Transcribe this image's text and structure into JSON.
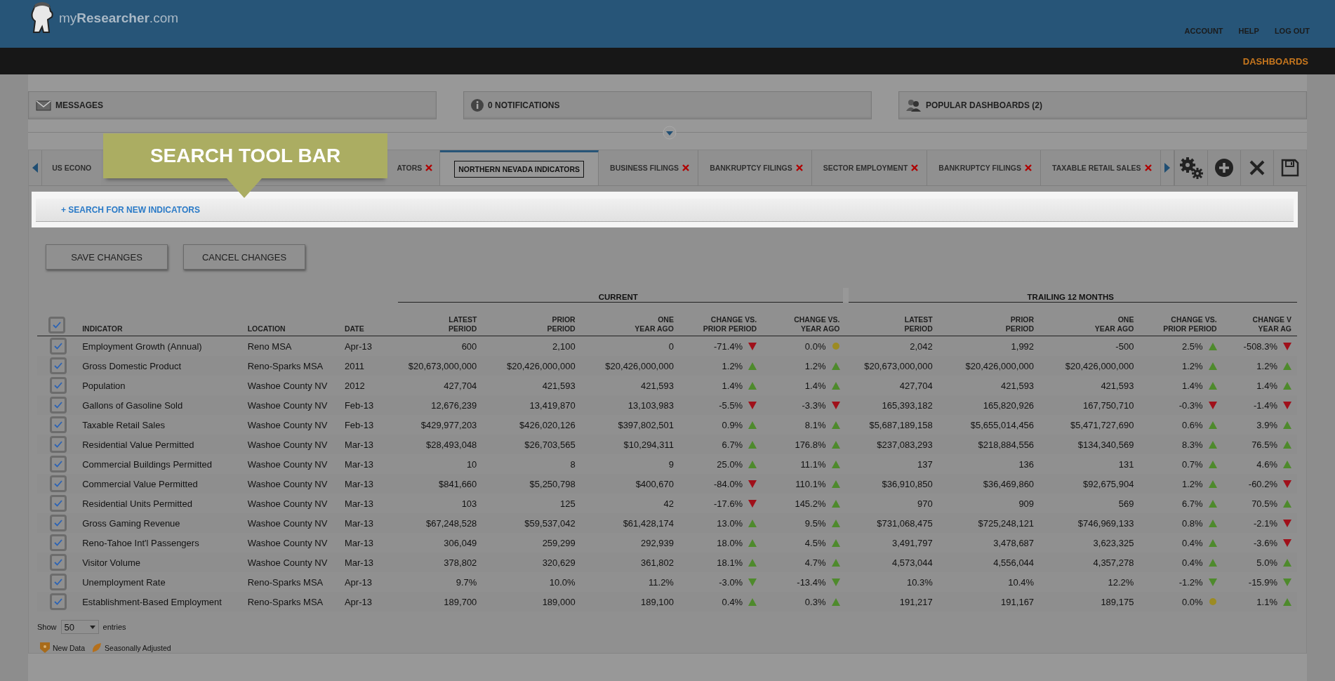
{
  "header": {
    "logo": "my**Researcher**.com",
    "links": [
      "ACCOUNT",
      "HELP",
      "LOG OUT"
    ]
  },
  "nav": {
    "items": [
      {
        "label": "DASHBOARDS",
        "selected": true
      }
    ]
  },
  "panels": [
    {
      "kind": "messages",
      "label": "MESSAGES"
    },
    {
      "kind": "notifications",
      "label": "0 NOTIFICATIONS"
    },
    {
      "kind": "popular",
      "label": "POPULAR DASHBOARDS (2)"
    }
  ],
  "tabs": [
    {
      "label": "US ECONO",
      "closable": false,
      "selected": false,
      "kind": "covered-start"
    },
    {
      "label": "ATORS",
      "closable": true,
      "selected": false,
      "kind": "covered-end"
    },
    {
      "label": "NORTHERN NEVADA INDICATORS",
      "closable": false,
      "selected": true,
      "kind": "tab"
    },
    {
      "label": "BUSINESS FILINGS",
      "closable": true,
      "selected": false,
      "kind": "tab"
    },
    {
      "label": "BANKRUPTCY FILINGS",
      "closable": true,
      "selected": false,
      "kind": "tab"
    },
    {
      "label": "SECTOR EMPLOYMENT",
      "closable": true,
      "selected": false,
      "kind": "tab"
    },
    {
      "label": "BANKRUPTCY FILINGS",
      "closable": true,
      "selected": false,
      "kind": "tab"
    },
    {
      "label": "TAXABLE RETAIL SALES",
      "closable": true,
      "selected": false,
      "kind": "tab"
    }
  ],
  "callout": {
    "label": "SEARCH TOOL BAR"
  },
  "search_link": "+ SEARCH FOR NEW INDICATORS",
  "buttons": [
    "SAVE CHANGES",
    "CANCEL CHANGES"
  ],
  "table": {
    "groups": [
      "CURRENT",
      "TRAILING 12 MONTHS"
    ],
    "all_checked": true,
    "columns": [
      "INDICATOR",
      "LOCATION",
      "DATE",
      "LATEST\nPERIOD",
      "PRIOR\nPERIOD",
      "ONE\nYEAR AGO",
      "CHANGE VS.\nPRIOR PERIOD",
      "CHANGE VS.\nYEAR AGO",
      "LATEST\nPERIOD",
      "PRIOR\nPERIOD",
      "ONE\nYEAR AGO",
      "CHANGE VS.\nPRIOR PERIOD",
      "CHANGE V\nYEAR AG"
    ],
    "rows": [
      {
        "checked": true,
        "cells": [
          "Employment Growth (Annual)",
          "Reno MSA",
          "Apr-13",
          "600",
          "2,100",
          "0",
          {
            "value": "-71.4%",
            "kind": "down"
          },
          {
            "value": "0.0%",
            "kind": "flat"
          },
          "2,042",
          "1,992",
          "-500",
          {
            "value": "2.5%",
            "kind": "up"
          },
          {
            "value": "-508.3%",
            "kind": "down"
          }
        ]
      },
      {
        "checked": true,
        "cells": [
          "Gross Domestic Product",
          "Reno-Sparks MSA",
          "2011",
          "$20,673,000,000",
          "$20,426,000,000",
          "$20,426,000,000",
          {
            "value": "1.2%",
            "kind": "up"
          },
          {
            "value": "1.2%",
            "kind": "up"
          },
          "$20,673,000,000",
          "$20,426,000,000",
          "$20,426,000,000",
          {
            "value": "1.2%",
            "kind": "up"
          },
          {
            "value": "1.2%",
            "kind": "up"
          }
        ]
      },
      {
        "checked": true,
        "cells": [
          "Population",
          "Washoe County NV",
          "2012",
          "427,704",
          "421,593",
          "421,593",
          {
            "value": "1.4%",
            "kind": "up"
          },
          {
            "value": "1.4%",
            "kind": "up"
          },
          "427,704",
          "421,593",
          "421,593",
          {
            "value": "1.4%",
            "kind": "up"
          },
          {
            "value": "1.4%",
            "kind": "up"
          }
        ]
      },
      {
        "checked": true,
        "cells": [
          "Gallons of Gasoline Sold",
          "Washoe County NV",
          "Feb-13",
          "12,676,239",
          "13,419,870",
          "13,103,983",
          {
            "value": "-5.5%",
            "kind": "down"
          },
          {
            "value": "-3.3%",
            "kind": "down"
          },
          "165,393,182",
          "165,820,926",
          "167,750,710",
          {
            "value": "-0.3%",
            "kind": "down"
          },
          {
            "value": "-1.4%",
            "kind": "down"
          }
        ]
      },
      {
        "checked": true,
        "cells": [
          "Taxable Retail Sales",
          "Washoe County NV",
          "Feb-13",
          "$429,977,203",
          "$426,020,126",
          "$397,802,501",
          {
            "value": "0.9%",
            "kind": "up"
          },
          {
            "value": "8.1%",
            "kind": "up"
          },
          "$5,687,189,158",
          "$5,655,014,456",
          "$5,471,727,690",
          {
            "value": "0.6%",
            "kind": "up"
          },
          {
            "value": "3.9%",
            "kind": "up"
          }
        ]
      },
      {
        "checked": true,
        "cells": [
          "Residential Value Permitted",
          "Washoe County NV",
          "Mar-13",
          "$28,493,048",
          "$26,703,565",
          "$10,294,311",
          {
            "value": "6.7%",
            "kind": "up"
          },
          {
            "value": "176.8%",
            "kind": "up"
          },
          "$237,083,293",
          "$218,884,556",
          "$134,340,569",
          {
            "value": "8.3%",
            "kind": "up"
          },
          {
            "value": "76.5%",
            "kind": "up"
          }
        ]
      },
      {
        "checked": true,
        "cells": [
          "Commercial Buildings Permitted",
          "Washoe County NV",
          "Mar-13",
          "10",
          "8",
          "9",
          {
            "value": "25.0%",
            "kind": "up"
          },
          {
            "value": "11.1%",
            "kind": "up"
          },
          "137",
          "136",
          "131",
          {
            "value": "0.7%",
            "kind": "up"
          },
          {
            "value": "4.6%",
            "kind": "up"
          }
        ]
      },
      {
        "checked": true,
        "cells": [
          "Commercial Value Permitted",
          "Washoe County NV",
          "Mar-13",
          "$841,660",
          "$5,250,798",
          "$400,670",
          {
            "value": "-84.0%",
            "kind": "down"
          },
          {
            "value": "110.1%",
            "kind": "up"
          },
          "$36,910,850",
          "$36,469,860",
          "$92,675,904",
          {
            "value": "1.2%",
            "kind": "up"
          },
          {
            "value": "-60.2%",
            "kind": "down"
          }
        ]
      },
      {
        "checked": true,
        "cells": [
          "Residential Units Permitted",
          "Washoe County NV",
          "Mar-13",
          "103",
          "125",
          "42",
          {
            "value": "-17.6%",
            "kind": "down"
          },
          {
            "value": "145.2%",
            "kind": "up"
          },
          "970",
          "909",
          "569",
          {
            "value": "6.7%",
            "kind": "up"
          },
          {
            "value": "70.5%",
            "kind": "up"
          }
        ]
      },
      {
        "checked": true,
        "cells": [
          "Gross Gaming Revenue",
          "Washoe County NV",
          "Mar-13",
          "$67,248,528",
          "$59,537,042",
          "$61,428,174",
          {
            "value": "13.0%",
            "kind": "up"
          },
          {
            "value": "9.5%",
            "kind": "up"
          },
          "$731,068,475",
          "$725,248,121",
          "$746,969,133",
          {
            "value": "0.8%",
            "kind": "up"
          },
          {
            "value": "-2.1%",
            "kind": "down"
          }
        ]
      },
      {
        "checked": true,
        "cells": [
          "Reno-Tahoe Int'l Passengers",
          "Washoe County NV",
          "Mar-13",
          "306,049",
          "259,299",
          "292,939",
          {
            "value": "18.0%",
            "kind": "up"
          },
          {
            "value": "4.5%",
            "kind": "up"
          },
          "3,491,797",
          "3,478,687",
          "3,623,325",
          {
            "value": "0.4%",
            "kind": "up"
          },
          {
            "value": "-3.6%",
            "kind": "down"
          }
        ]
      },
      {
        "checked": true,
        "cells": [
          "Visitor Volume",
          "Washoe County NV",
          "Mar-13",
          "378,802",
          "320,629",
          "361,802",
          {
            "value": "18.1%",
            "kind": "up"
          },
          {
            "value": "4.7%",
            "kind": "up"
          },
          "4,573,044",
          "4,556,044",
          "4,357,278",
          {
            "value": "0.4%",
            "kind": "up"
          },
          {
            "value": "5.0%",
            "kind": "up"
          }
        ]
      },
      {
        "checked": true,
        "cells": [
          "Unemployment Rate",
          "Reno-Sparks MSA",
          "Apr-13",
          "9.7%",
          "10.0%",
          "11.2%",
          {
            "value": "-3.0%",
            "kind": "falling"
          },
          {
            "value": "-13.4%",
            "kind": "falling"
          },
          "10.3%",
          "10.4%",
          "12.2%",
          {
            "value": "-1.2%",
            "kind": "falling"
          },
          {
            "value": "-15.9%",
            "kind": "falling"
          }
        ]
      },
      {
        "checked": true,
        "cells": [
          "Establishment-Based Employment",
          "Reno-Sparks MSA",
          "Apr-13",
          "189,700",
          "189,000",
          "189,100",
          {
            "value": "0.4%",
            "kind": "up"
          },
          {
            "value": "0.3%",
            "kind": "up"
          },
          "191,217",
          "191,167",
          "189,175",
          {
            "value": "0.0%",
            "kind": "flat"
          },
          {
            "value": "1.1%",
            "kind": "up"
          }
        ]
      }
    ]
  },
  "entries": {
    "before": "Show",
    "value": "50",
    "after": "entries"
  },
  "legend": [
    {
      "kind": "new",
      "label": "New Data"
    },
    {
      "kind": "seasonal",
      "label": "Seasonally Adjusted"
    }
  ]
}
